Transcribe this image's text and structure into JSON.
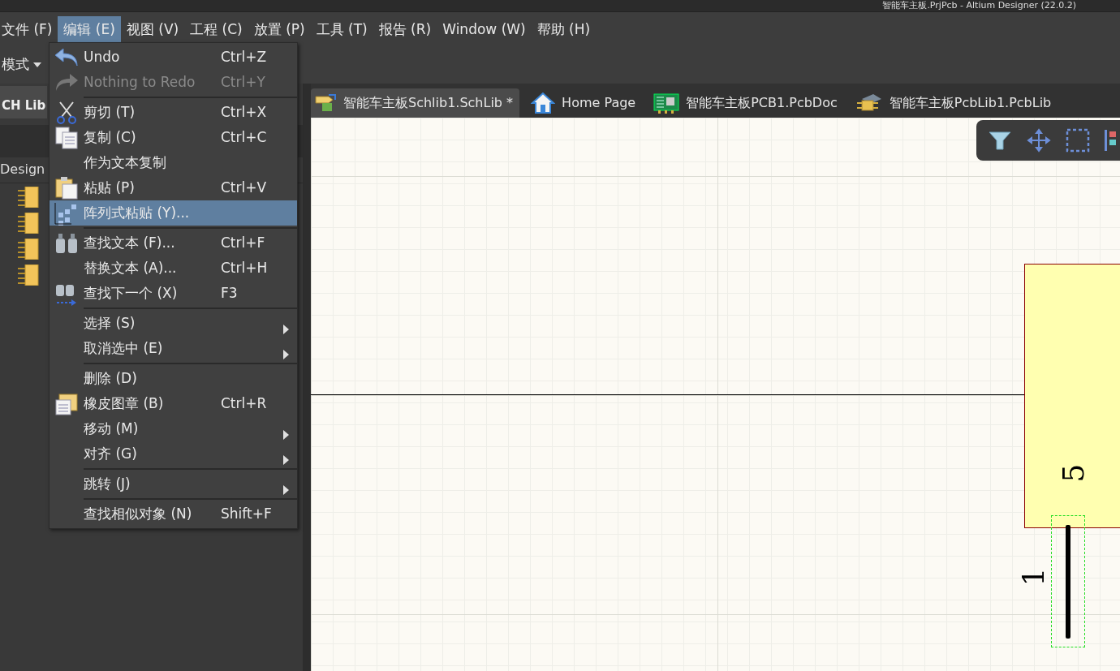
{
  "window": {
    "title": "智能车主板.PrjPcb - Altium Designer (22.0.2)"
  },
  "menu_bar": [
    {
      "label": "文件 (F)",
      "selected": false
    },
    {
      "label": "编辑 (E)",
      "selected": true
    },
    {
      "label": "视图 (V)",
      "selected": false
    },
    {
      "label": "工程 (C)",
      "selected": false
    },
    {
      "label": "放置 (P)",
      "selected": false
    },
    {
      "label": "工具 (T)",
      "selected": false
    },
    {
      "label": "报告 (R)",
      "selected": false
    },
    {
      "label": "Window (W)",
      "selected": false
    },
    {
      "label": "帮助 (H)",
      "selected": false
    }
  ],
  "toolbar": {
    "mode_dropdown": "模式"
  },
  "left_panel": {
    "tab": "CH Lib",
    "header": "Design"
  },
  "doc_tabs": [
    {
      "label": "智能车主板Schlib1.SchLib *",
      "selected": true
    },
    {
      "label": "Home Page",
      "selected": false
    },
    {
      "label": "智能车主板PCB1.PcbDoc",
      "selected": false
    },
    {
      "label": "智能车主板PcbLib1.PcbLib",
      "selected": false
    }
  ],
  "edit_menu": [
    {
      "kind": "item",
      "label": "Undo",
      "shortcut": "Ctrl+Z",
      "disabled": false,
      "selected": false
    },
    {
      "kind": "item",
      "label": "Nothing to Redo",
      "shortcut": "Ctrl+Y",
      "disabled": true,
      "selected": false
    },
    {
      "kind": "separator"
    },
    {
      "kind": "item",
      "label": "剪切 (T)",
      "shortcut": "Ctrl+X",
      "disabled": false,
      "selected": false
    },
    {
      "kind": "item",
      "label": "复制 (C)",
      "shortcut": "Ctrl+C",
      "disabled": false,
      "selected": false
    },
    {
      "kind": "item",
      "label": "作为文本复制",
      "disabled": false,
      "selected": false
    },
    {
      "kind": "item",
      "label": "粘贴 (P)",
      "shortcut": "Ctrl+V",
      "disabled": false,
      "selected": false
    },
    {
      "kind": "item",
      "label": "阵列式粘贴 (Y)...",
      "disabled": false,
      "selected": true
    },
    {
      "kind": "separator"
    },
    {
      "kind": "item",
      "label": "查找文本 (F)...",
      "shortcut": "Ctrl+F",
      "disabled": false,
      "selected": false
    },
    {
      "kind": "item",
      "label": "替换文本 (A)...",
      "shortcut": "Ctrl+H",
      "disabled": false,
      "selected": false
    },
    {
      "kind": "item",
      "label": "查找下一个 (X)",
      "shortcut": "F3",
      "disabled": false,
      "selected": false
    },
    {
      "kind": "separator"
    },
    {
      "kind": "submenu",
      "label": "选择 (S)",
      "disabled": false,
      "selected": false
    },
    {
      "kind": "submenu",
      "label": "取消选中 (E)",
      "disabled": false,
      "selected": false
    },
    {
      "kind": "separator"
    },
    {
      "kind": "item",
      "label": "删除 (D)",
      "disabled": false,
      "selected": false
    },
    {
      "kind": "item",
      "label": "橡皮图章 (B)",
      "shortcut": "Ctrl+R",
      "disabled": false,
      "selected": false
    },
    {
      "kind": "submenu",
      "label": "移动 (M)",
      "disabled": false,
      "selected": false
    },
    {
      "kind": "submenu",
      "label": "对齐 (G)",
      "disabled": false,
      "selected": false
    },
    {
      "kind": "separator"
    },
    {
      "kind": "submenu",
      "label": "跳转 (J)",
      "disabled": false,
      "selected": false
    },
    {
      "kind": "separator"
    },
    {
      "kind": "item",
      "label": "查找相似对象 (N)",
      "shortcut": "Shift+F",
      "disabled": false,
      "selected": false
    }
  ],
  "canvas": {
    "pins": [
      {
        "number": "5"
      },
      {
        "number": "1"
      }
    ]
  }
}
